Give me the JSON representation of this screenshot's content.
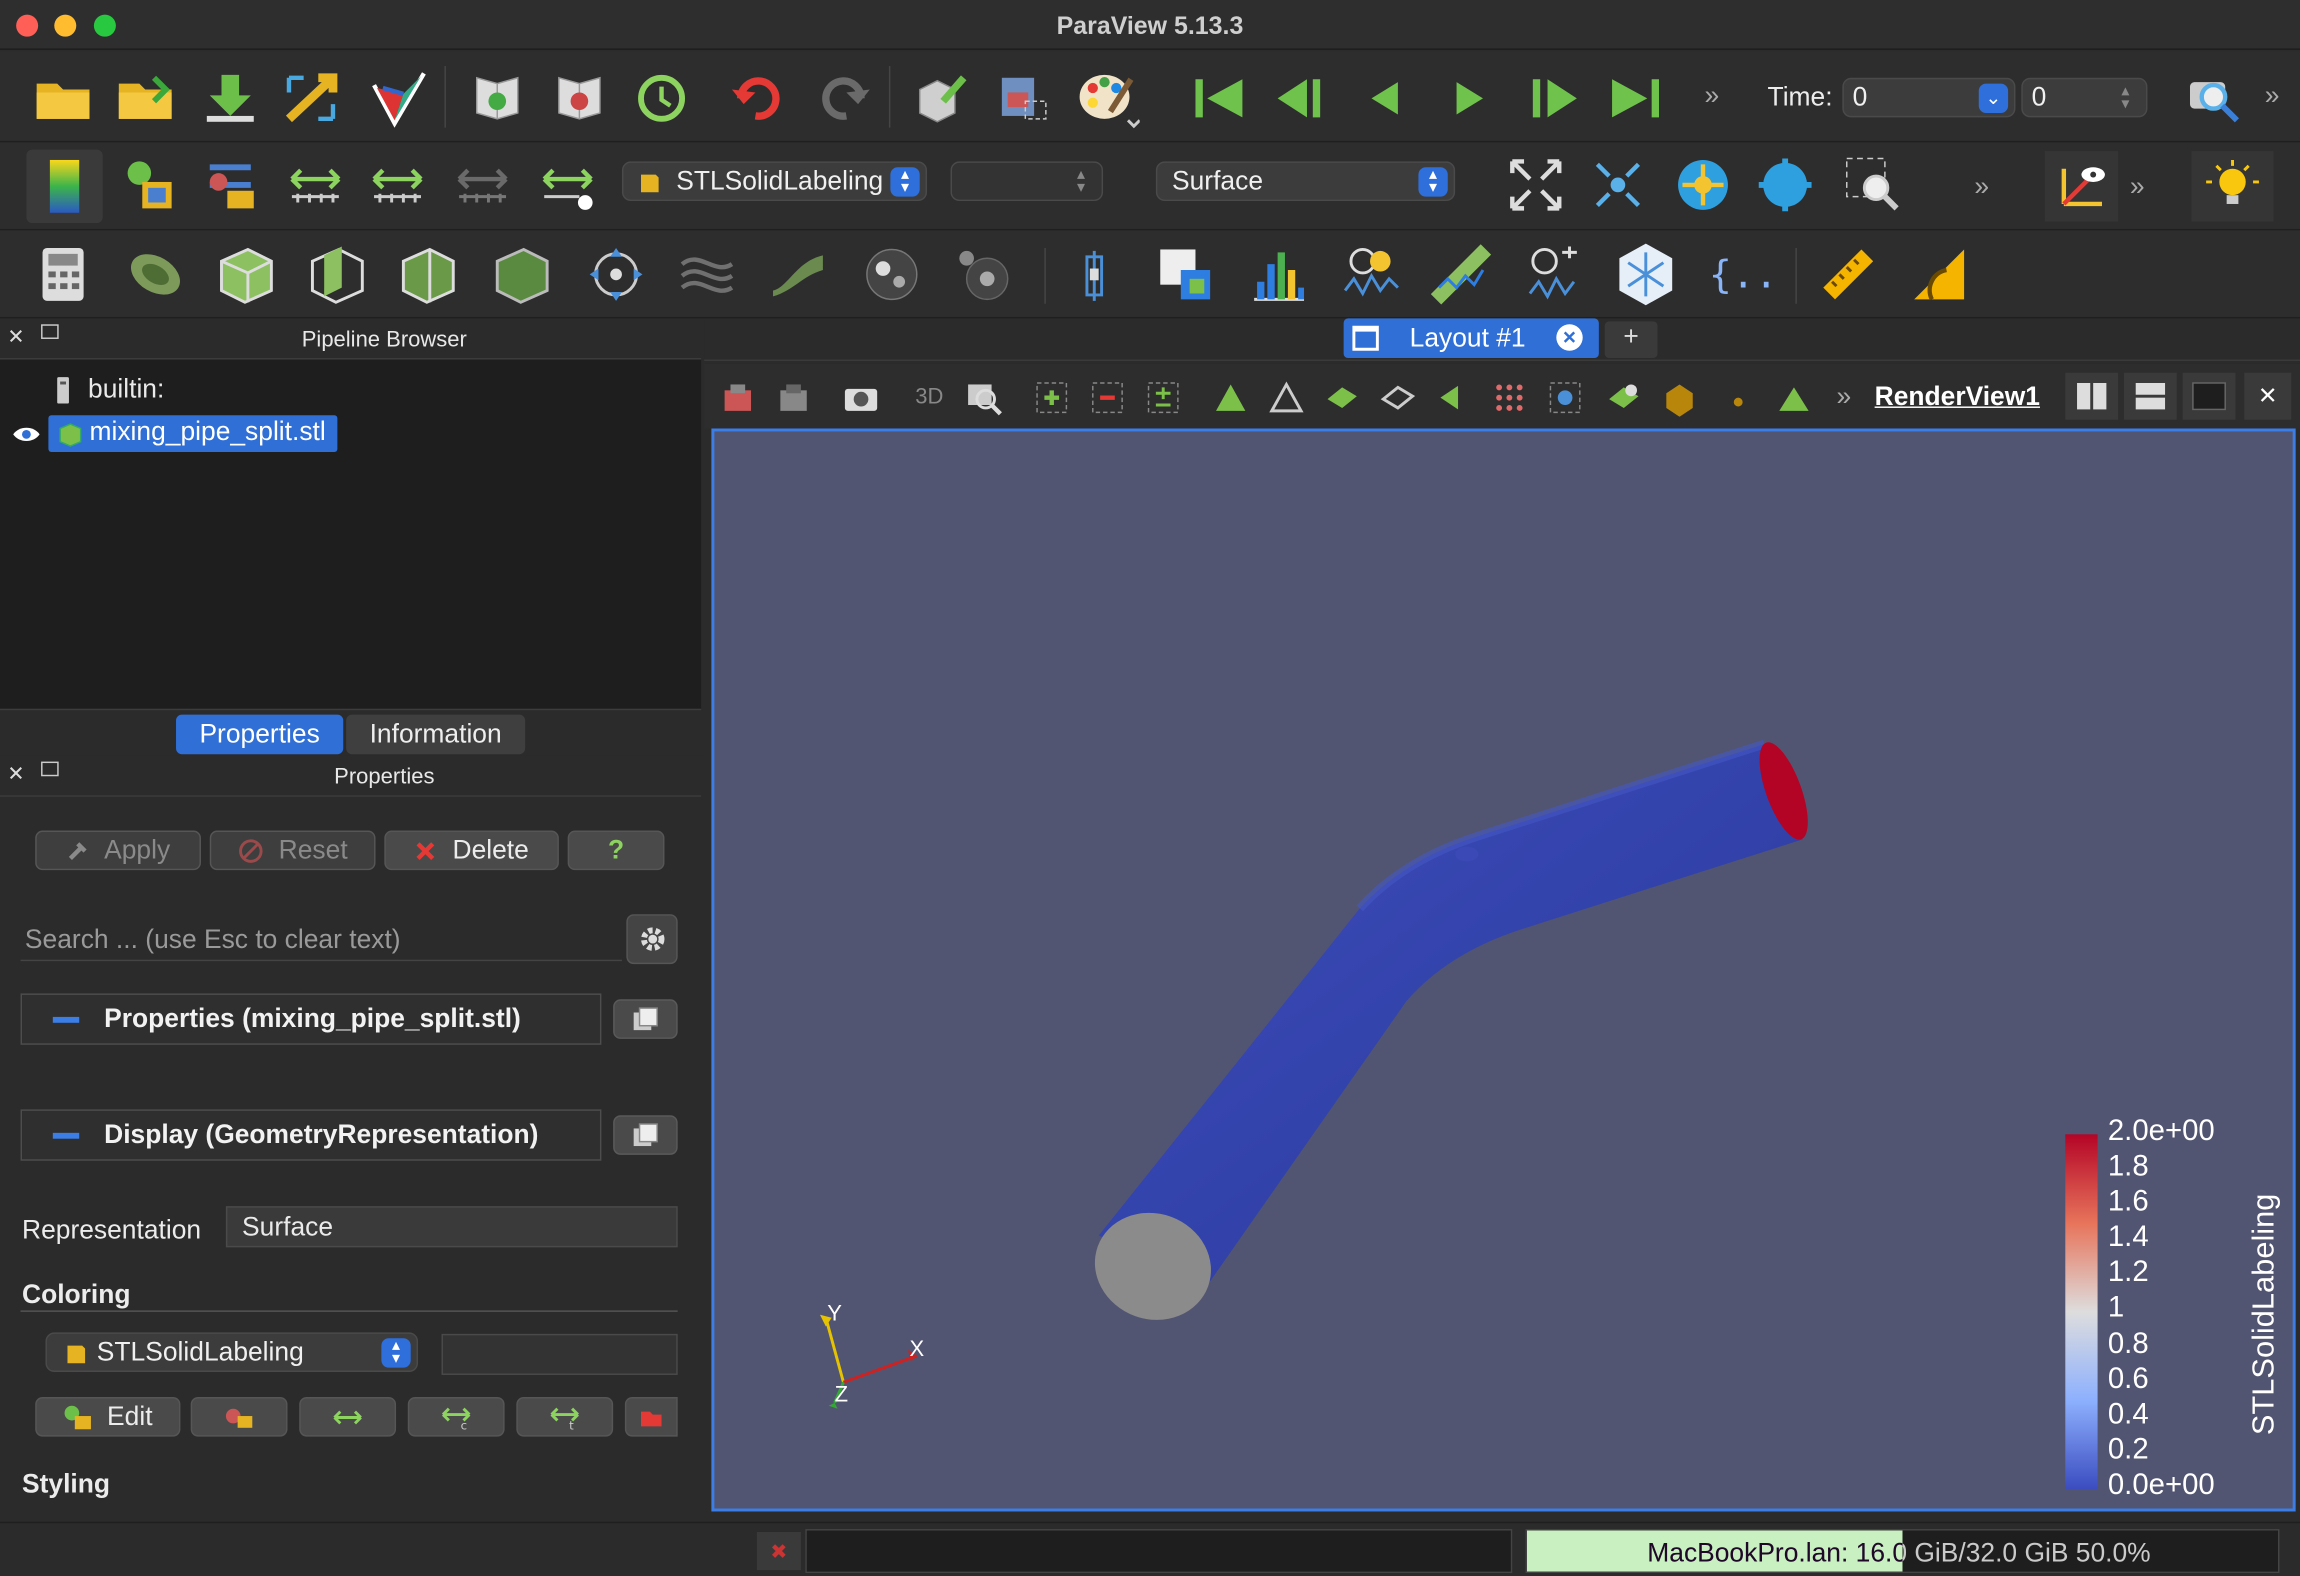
{
  "window": {
    "title": "ParaView 5.13.3"
  },
  "toolbar1": {
    "time_label": "Time:",
    "time_value": "0",
    "timestep_value": "0"
  },
  "toolbar2": {
    "color_array": "STLSolidLabeling",
    "component": "",
    "representation": "Surface"
  },
  "pipeline_browser": {
    "title": "Pipeline Browser",
    "items": [
      {
        "label": "builtin:"
      },
      {
        "label": "mixing_pipe_split.stl"
      }
    ]
  },
  "tabs": {
    "properties": "Properties",
    "information": "Information"
  },
  "properties_panel": {
    "title": "Properties",
    "apply": "Apply",
    "reset": "Reset",
    "delete": "Delete",
    "help": "?",
    "search_placeholder": "Search ... (use Esc to clear text)",
    "section_properties": "Properties (mixing_pipe_split.stl)",
    "section_display": "Display (GeometryRepresentation)",
    "representation_label": "Representation",
    "representation_value": "Surface",
    "coloring_heading": "Coloring",
    "coloring_array": "STLSolidLabeling",
    "edit": "Edit",
    "styling_heading": "Styling"
  },
  "layout": {
    "tab_label": "Layout #1",
    "add_tab": "+"
  },
  "render_view": {
    "name": "RenderView1",
    "mode_3d": "3D",
    "background_color": "#525571"
  },
  "orientation_axes": {
    "x": "X",
    "y": "Y",
    "z": "Z"
  },
  "color_legend": {
    "title": "STLSolidLabeling",
    "ticks": [
      "2.0e+00",
      "1.8",
      "1.6",
      "1.4",
      "1.2",
      "1",
      "0.8",
      "0.6",
      "0.4",
      "0.2",
      "0.0e+00"
    ],
    "colors": {
      "high": "#b40426",
      "mid": "#dddddd",
      "low": "#3b4cc0"
    }
  },
  "status_bar": {
    "memory": "MacBookPro.lan: 16.0 GiB/32.0 GiB 50.0%",
    "memory_fraction": 0.5
  }
}
